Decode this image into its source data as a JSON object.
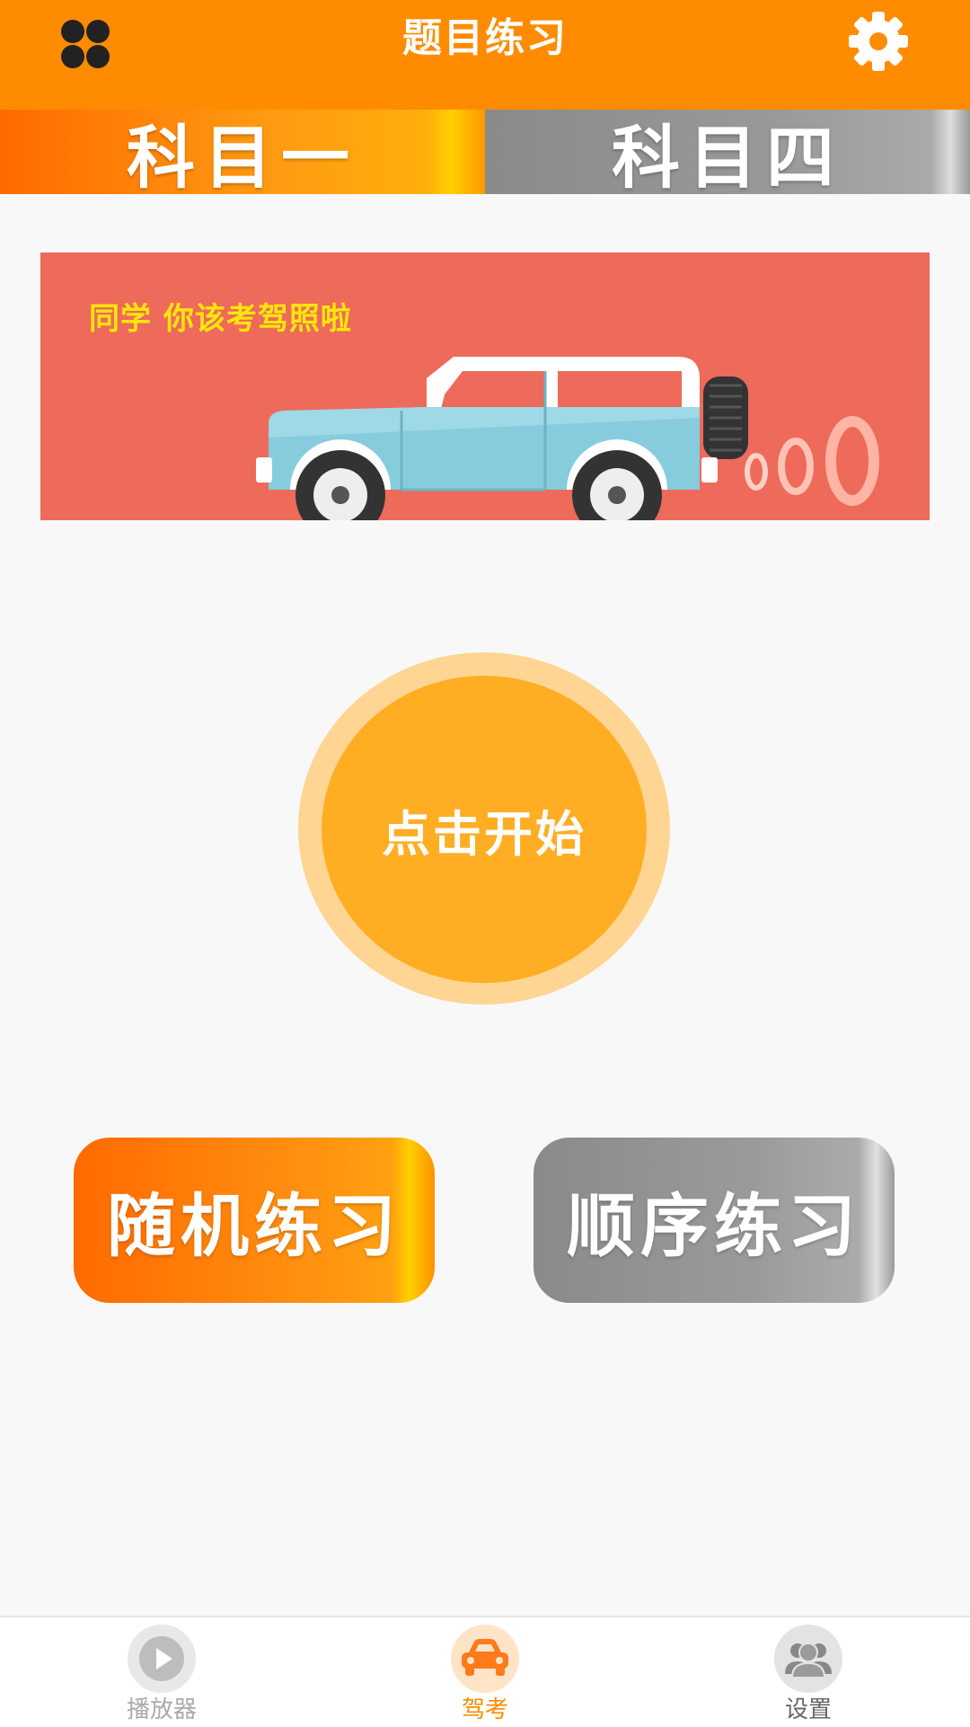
{
  "header": {
    "title": "题目练习",
    "menu_icon": "four-leaf-grid-icon",
    "settings_icon": "gear-icon"
  },
  "tabs": [
    {
      "label": "科目一",
      "active": true
    },
    {
      "label": "科目四",
      "active": false
    }
  ],
  "banner": {
    "slogan": "同学 你该考驾照啦",
    "illustration": "jeep-icon"
  },
  "start_button": {
    "label": "点击开始"
  },
  "practice": {
    "random_label": "随机练习",
    "sequential_label": "顺序练习"
  },
  "bottom_nav": [
    {
      "label": "播放器",
      "icon": "play-icon",
      "active": false
    },
    {
      "label": "驾考",
      "icon": "car-icon",
      "active": true
    },
    {
      "label": "设置",
      "icon": "users-icon",
      "active": false
    }
  ],
  "colors": {
    "primary": "#ff8c00",
    "banner_bg": "#ee6a5a",
    "slogan": "#ffe60a",
    "start_button": "#ffae24",
    "inactive_gray": "#999999"
  }
}
